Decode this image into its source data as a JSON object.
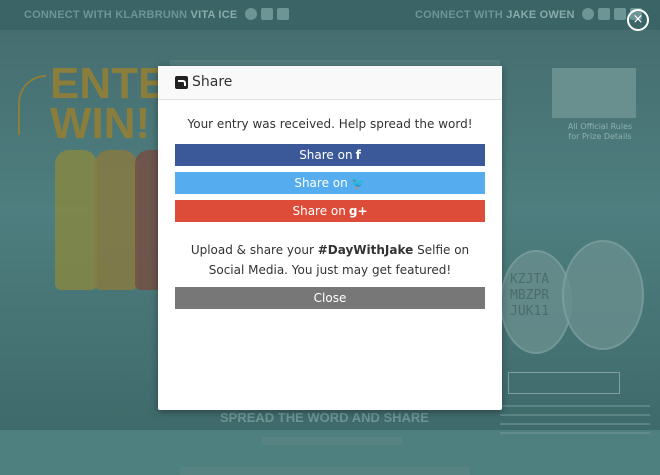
{
  "background": {
    "connect_left_prefix": "CONNECT WITH KLARBRUNN",
    "connect_left_brand": "VITA ICE",
    "connect_right_prefix": "CONNECT WITH",
    "connect_right_brand": "JAKE OWEN",
    "enter": "ENTER.",
    "win": "WIN!",
    "prize_note": "All Official Rules for Prize Details",
    "code_lines": [
      "KZJTA",
      "MBZPR",
      "JUK11"
    ],
    "spread_word": "SPREAD THE WORD AND SHARE"
  },
  "overlay": {
    "close_icon": "×"
  },
  "modal": {
    "title": "Share",
    "received_text": "Your entry was received. Help spread the word!",
    "facebook_label": "Share on",
    "facebook_icon": "f",
    "twitter_label": "Share on",
    "twitter_icon": "🐦",
    "google_label": "Share on",
    "google_icon": "g+",
    "upload_text_1": "Upload & share your",
    "upload_hashtag": "#DayWithJake",
    "upload_text_2": "Selfie on Social Media. You just may get featured!",
    "close_label": "Close"
  },
  "colors": {
    "facebook": "#3b5998",
    "twitter": "#55acee",
    "google": "#dd4b39",
    "close": "#777777"
  }
}
